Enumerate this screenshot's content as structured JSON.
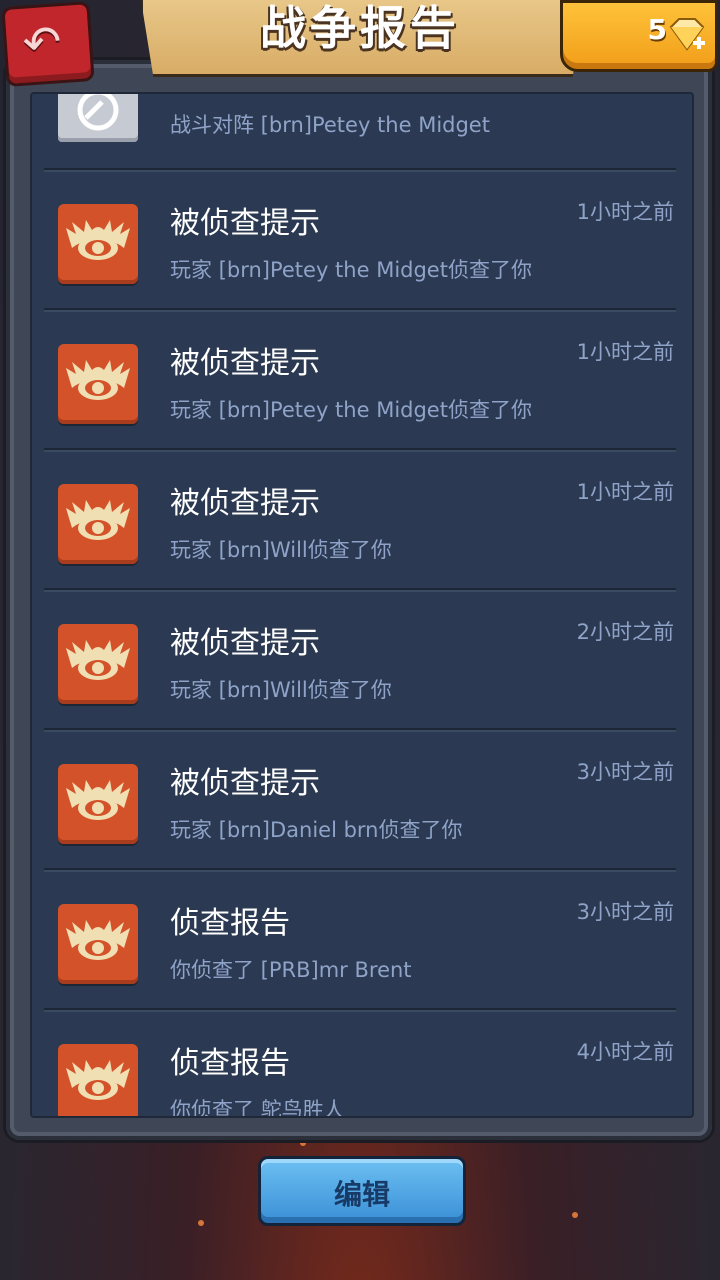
{
  "header": {
    "title": "战争报告",
    "gems": "5"
  },
  "reports": [
    {
      "title": "",
      "desc": "战斗对阵 [brn]Petey the Midget",
      "time": "",
      "icon": "battle-shield-icon"
    },
    {
      "title": "被侦查提示",
      "desc": "玩家 [brn]Petey the Midget侦查了你",
      "time": "1小时之前",
      "icon": "scout-eye-icon"
    },
    {
      "title": "被侦查提示",
      "desc": "玩家 [brn]Petey the Midget侦查了你",
      "time": "1小时之前",
      "icon": "scout-eye-icon"
    },
    {
      "title": "被侦查提示",
      "desc": "玩家 [brn]Will侦查了你",
      "time": "1小时之前",
      "icon": "scout-eye-icon"
    },
    {
      "title": "被侦查提示",
      "desc": "玩家 [brn]Will侦查了你",
      "time": "2小时之前",
      "icon": "scout-eye-icon"
    },
    {
      "title": "被侦查提示",
      "desc": "玩家 [brn]Daniel brn侦查了你",
      "time": "3小时之前",
      "icon": "scout-eye-icon"
    },
    {
      "title": "侦查报告",
      "desc": "你侦查了 [PRB]mr Brent",
      "time": "3小时之前",
      "icon": "scout-eye-icon"
    },
    {
      "title": "侦查报告",
      "desc": "你侦查了 鸵鸟胜人",
      "time": "4小时之前",
      "icon": "scout-eye-icon"
    }
  ],
  "footer": {
    "edit_label": "编辑"
  },
  "colors": {
    "accent": "#d4522a",
    "panel": "#2b3a52",
    "button": "#3a8fd6",
    "gold": "#f19d18"
  }
}
